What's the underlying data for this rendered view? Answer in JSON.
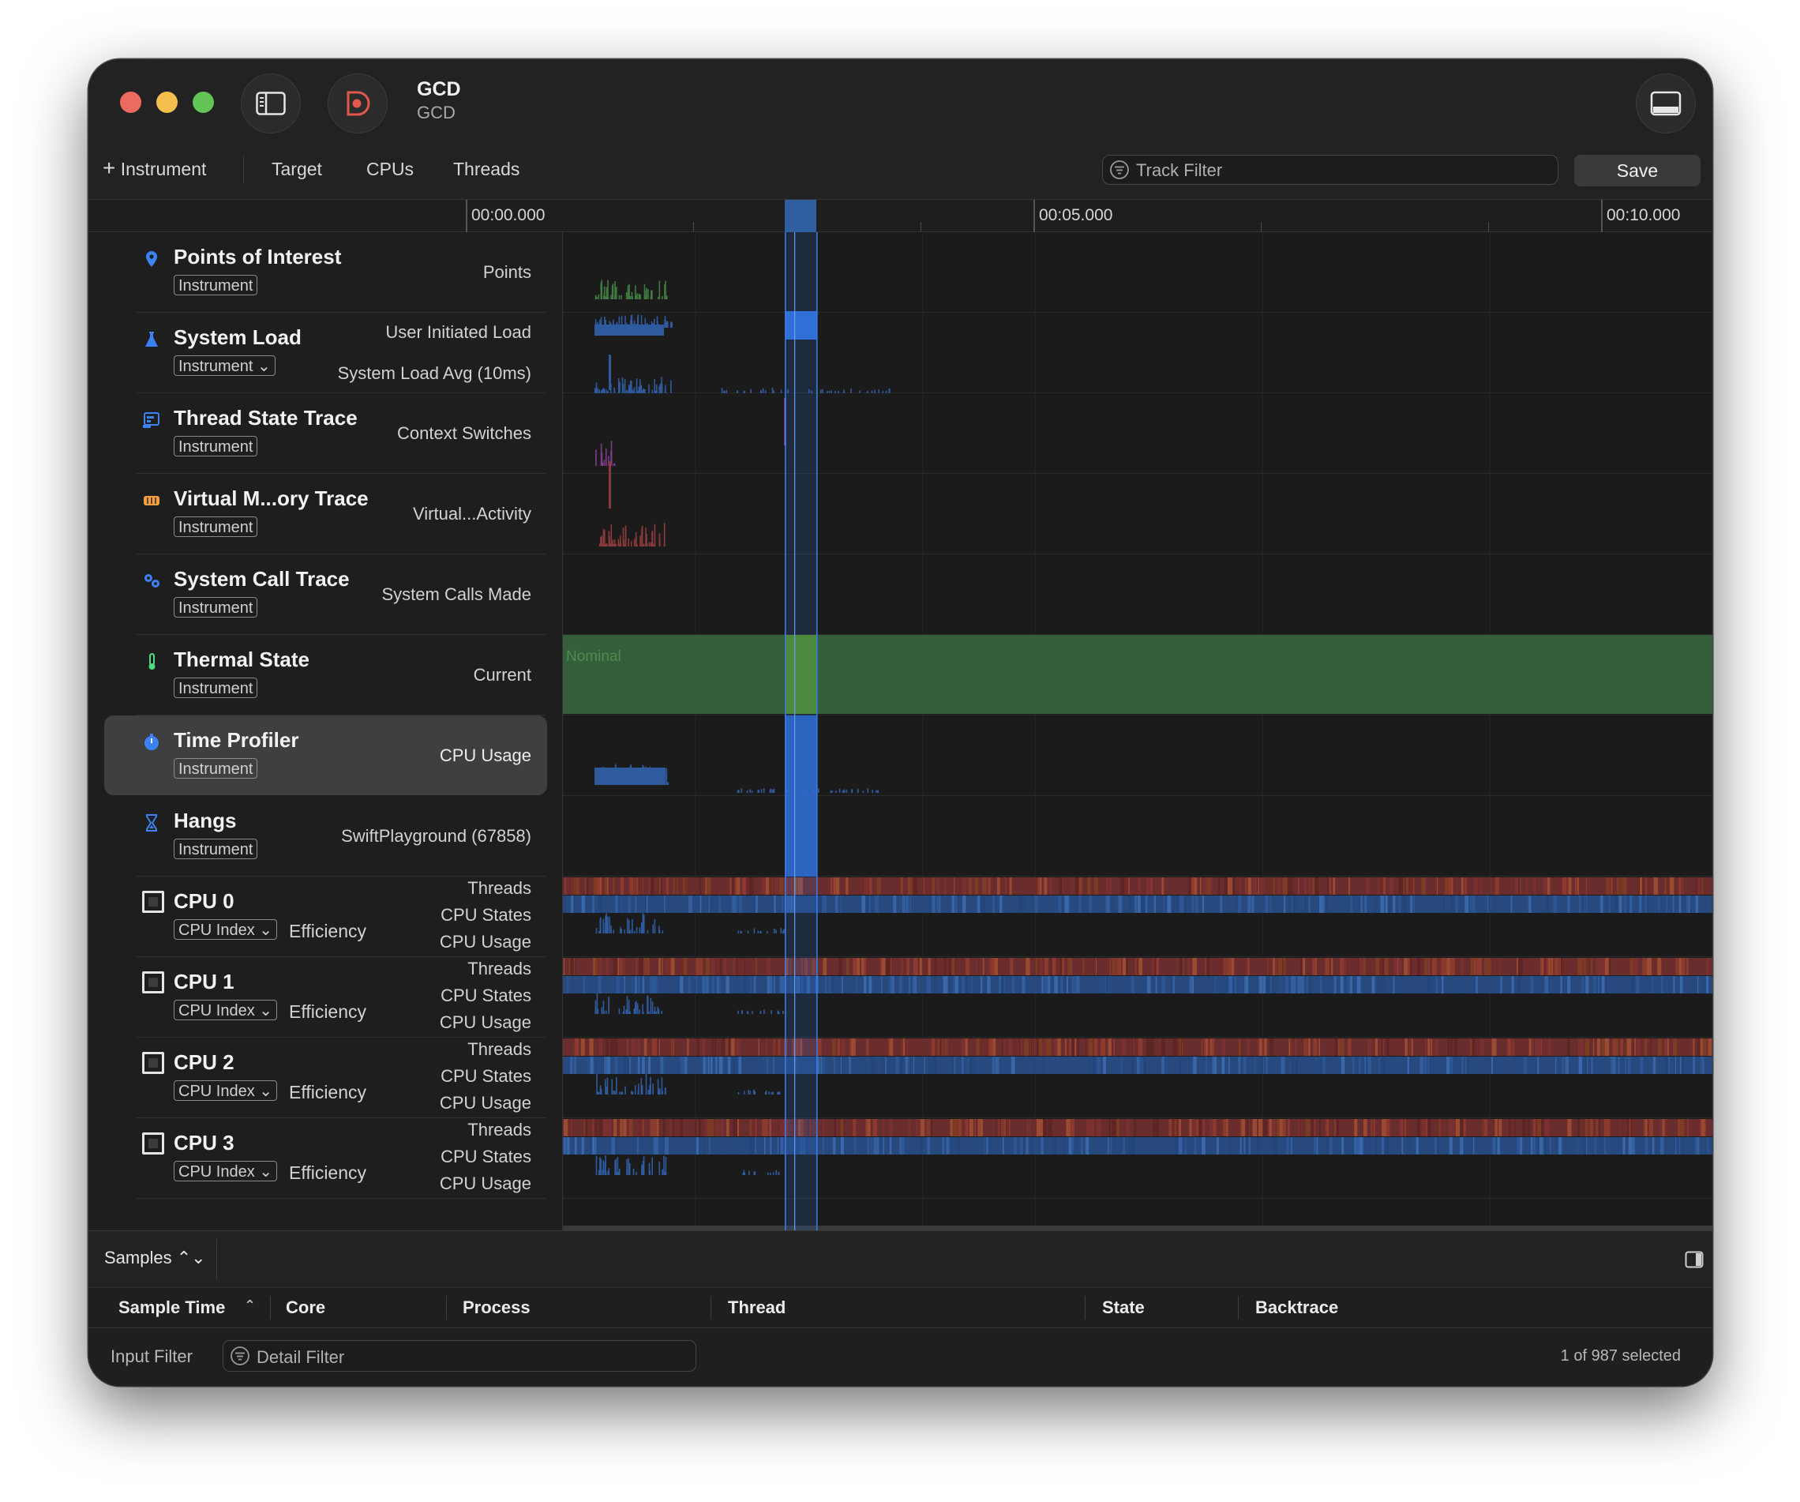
{
  "window": {
    "title": "GCD",
    "subtitle": "GCD"
  },
  "toolbar": {
    "add_instrument": "Instrument",
    "target": "Target",
    "cpus": "CPUs",
    "threads": "Threads",
    "track_filter_placeholder": "Track Filter",
    "save_label": "Save"
  },
  "ruler": {
    "labels": [
      "00:00.000",
      "00:05.000",
      "00:10.000"
    ]
  },
  "tracks": [
    {
      "name": "Points of Interest",
      "badge": "Instrument",
      "right": [
        "Points"
      ],
      "icon": "pin-icon",
      "color": "#3b82f6"
    },
    {
      "name": "System Load",
      "badge": "Instrument ⌄",
      "right": [
        "User Initiated Load",
        "System Load Avg (10ms)"
      ],
      "icon": "flask-icon",
      "color": "#3b82f6"
    },
    {
      "name": "Thread State Trace",
      "badge": "Instrument",
      "right": [
        "Context Switches"
      ],
      "icon": "thread-state-icon",
      "color": "#3b82f6"
    },
    {
      "name": "Virtual M...ory Trace",
      "badge": "Instrument",
      "right": [
        "Virtual...Activity"
      ],
      "icon": "memory-icon",
      "color": "#f59e42"
    },
    {
      "name": "System Call Trace",
      "badge": "Instrument",
      "right": [
        "System Calls Made"
      ],
      "icon": "gears-icon",
      "color": "#3b82f6"
    },
    {
      "name": "Thermal State",
      "badge": "Instrument",
      "right": [
        "Current"
      ],
      "icon": "thermometer-icon",
      "color": "#4ade80"
    },
    {
      "name": "Time Profiler",
      "badge": "Instrument",
      "right": [
        "CPU Usage"
      ],
      "icon": "stopwatch-icon",
      "color": "#3b82f6"
    },
    {
      "name": "Hangs",
      "badge": "Instrument",
      "right": [
        "SwiftPlayground (67858)"
      ],
      "icon": "hourglass-icon",
      "color": "#3b82f6"
    },
    {
      "name": "CPU 0",
      "badge": "CPU Index ⌄",
      "eff": "Efficiency",
      "right": [
        "Threads",
        "CPU States",
        "CPU Usage"
      ],
      "icon": "cpu-icon"
    },
    {
      "name": "CPU 1",
      "badge": "CPU Index ⌄",
      "eff": "Efficiency",
      "right": [
        "Threads",
        "CPU States",
        "CPU Usage"
      ],
      "icon": "cpu-icon"
    },
    {
      "name": "CPU 2",
      "badge": "CPU Index ⌄",
      "eff": "Efficiency",
      "right": [
        "Threads",
        "CPU States",
        "CPU Usage"
      ],
      "icon": "cpu-icon"
    },
    {
      "name": "CPU 3",
      "badge": "CPU Index ⌄",
      "eff": "Efficiency",
      "right": [
        "Threads",
        "CPU States",
        "CPU Usage"
      ],
      "icon": "cpu-icon"
    }
  ],
  "thermal": {
    "label": "Nominal"
  },
  "bottom": {
    "samples_label": "Samples ⌃⌄",
    "columns": [
      "Sample Time",
      "Core",
      "Process",
      "Thread",
      "State",
      "Backtrace"
    ],
    "input_filter": "Input Filter",
    "detail_filter_placeholder": "Detail Filter",
    "selection_count": "1 of 987 selected"
  },
  "colors": {
    "accent_blue": "#2f6fd6",
    "thermal_green": "#355e3b",
    "thread_red": "#7a3030",
    "traffic_red": "#ed6a5e",
    "traffic_yellow": "#f5bf4f",
    "traffic_green": "#61c454"
  }
}
